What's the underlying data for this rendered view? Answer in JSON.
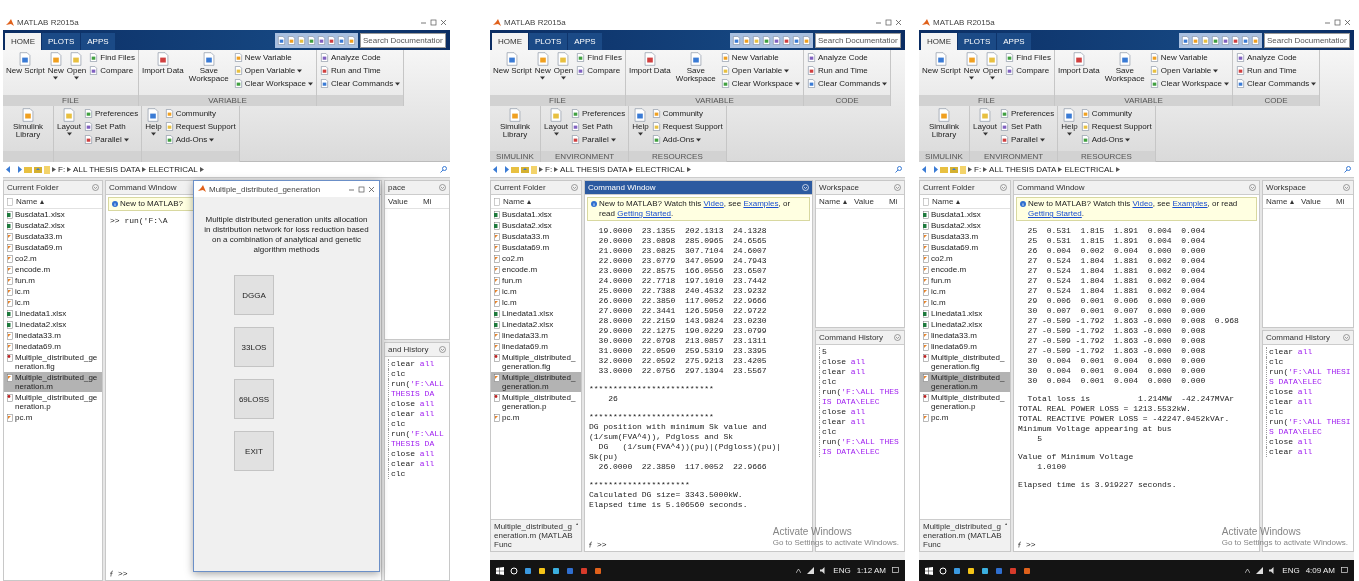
{
  "screens": [
    {
      "title": "MATLAB R2015a",
      "tabs": [
        {
          "label": "HOME",
          "selected": true
        },
        {
          "label": "PLOTS",
          "selected": false
        },
        {
          "label": "APPS",
          "selected": false
        }
      ],
      "search": {
        "placeholder": "Search Documentation"
      },
      "ribbon": [
        {
          "label": "FILE",
          "columns": [
            [
              {
                "kind": "large",
                "label": "New Script",
                "menu": false
              }
            ],
            [
              {
                "kind": "large",
                "label": "New",
                "menu": true
              }
            ],
            [
              {
                "kind": "large",
                "label": "Open",
                "menu": true
              }
            ],
            [
              {
                "kind": "small",
                "label": "Find Files",
                "menu": false
              },
              {
                "kind": "small",
                "label": "Compare",
                "menu": false
              }
            ]
          ]
        },
        {
          "label": "VARIABLE",
          "columns": [
            [
              {
                "kind": "large",
                "label": "Import Data",
                "menu": false
              }
            ],
            [
              {
                "kind": "large",
                "label": "Save Workspace",
                "menu": false
              }
            ],
            [
              {
                "kind": "small",
                "label": "New Variable",
                "menu": false
              },
              {
                "kind": "small",
                "label": "Open Variable",
                "menu": true
              },
              {
                "kind": "small",
                "label": "Clear Workspace",
                "menu": true
              }
            ]
          ]
        },
        {
          "columns": [
            [
              {
                "kind": "small",
                "label": "Analyze Code",
                "menu": false
              },
              {
                "kind": "small",
                "label": "Run and Time",
                "menu": false
              },
              {
                "kind": "small",
                "label": "Clear Commands",
                "menu": true
              }
            ]
          ]
        },
        {
          "columns": [
            [
              {
                "kind": "large",
                "label": "Simulink Library",
                "menu": false
              }
            ]
          ]
        },
        {
          "columns": [
            [
              {
                "kind": "large",
                "label": "Layout",
                "menu": true
              }
            ],
            [
              {
                "kind": "small",
                "label": "Preferences",
                "menu": false
              },
              {
                "kind": "small",
                "label": "Set Path",
                "menu": false
              },
              {
                "kind": "small",
                "label": "Parallel",
                "menu": true
              }
            ]
          ]
        },
        {
          "columns": [
            [
              {
                "kind": "large",
                "label": "Help",
                "menu": true
              }
            ],
            [
              {
                "kind": "small",
                "label": "Community",
                "menu": false
              },
              {
                "kind": "small",
                "label": "Request Support",
                "menu": false
              },
              {
                "kind": "small",
                "label": "Add-Ons",
                "menu": true
              }
            ]
          ]
        }
      ],
      "path": [
        "F:",
        "ALL THESIS DATA",
        "ELECTRICAL"
      ],
      "folder": {
        "title": "Current Folder",
        "column": "Name ▴",
        "files": [
          {
            "name": "Busdata1.xlsx",
            "kind": "sheet",
            "selected": false
          },
          {
            "name": "Busdata2.xlsx",
            "kind": "sheet",
            "selected": false
          },
          {
            "name": "Busdata33.m",
            "kind": "script",
            "selected": false
          },
          {
            "name": "Busdata69.m",
            "kind": "script",
            "selected": false
          },
          {
            "name": "co2.m",
            "kind": "script",
            "selected": false
          },
          {
            "name": "encode.m",
            "kind": "script",
            "selected": false
          },
          {
            "name": "fun.m",
            "kind": "script",
            "selected": false
          },
          {
            "name": "ic.m",
            "kind": "script",
            "selected": false
          },
          {
            "name": "lc.m",
            "kind": "script",
            "selected": false
          },
          {
            "name": "Linedata1.xlsx",
            "kind": "sheet",
            "selected": false
          },
          {
            "name": "Linedata2.xlsx",
            "kind": "sheet",
            "selected": false
          },
          {
            "name": "linedata33.m",
            "kind": "script",
            "selected": false
          },
          {
            "name": "linedata69.m",
            "kind": "script",
            "selected": false
          },
          {
            "name": "Multiple_distributed_generation.fig",
            "kind": "figure",
            "selected": false
          },
          {
            "name": "Multiple_distributed_generation.m",
            "kind": "script",
            "selected": true
          },
          {
            "name": "Multiple_distributed_generation.p",
            "kind": "figure",
            "selected": false
          },
          {
            "name": "pc.m",
            "kind": "script",
            "selected": false
          }
        ]
      },
      "command_window": {
        "title": "Command Window",
        "active": false,
        "info": [
          {
            "text": "New to MATLAB?",
            "link": false
          }
        ],
        "blocks": [
          [
            ">> run('F:\\A"
          ]
        ],
        "prompt": ">>"
      },
      "workspace": {
        "title": "pace",
        "columns": [
          "Value",
          "Mi"
        ]
      },
      "history": {
        "title": "and History",
        "items": [
          {
            "cmd": "clear",
            "arg": "all"
          },
          {
            "cmd": "clc"
          },
          {
            "cmd": "run(",
            "arg": "'F:\\ALL THESIS DA"
          },
          {
            "cmd": "close",
            "arg": "all"
          },
          {
            "cmd": "clear",
            "arg": "all"
          },
          {
            "cmd": "clc"
          },
          {
            "cmd": "run(",
            "arg": "'F:\\ALL THESIS DA"
          },
          {
            "cmd": "close",
            "arg": "all"
          },
          {
            "cmd": "clear",
            "arg": "all"
          },
          {
            "cmd": "clc"
          }
        ]
      },
      "dialog": {
        "title": "Multiple_distributed_generation",
        "heading": "Multiple distributed generation units allocation in distribution network for loss reduction based on a combination of analytical and genetic algorithm methods",
        "buttons": [
          "DGGA",
          "33LOS",
          "69LOSS",
          "EXIT"
        ]
      }
    },
    {
      "title": "MATLAB R2015a",
      "tabs": [
        {
          "label": "HOME",
          "selected": true
        },
        {
          "label": "PLOTS",
          "selected": false
        },
        {
          "label": "APPS",
          "selected": false
        }
      ],
      "search": {
        "placeholder": "Search Documentation"
      },
      "ribbon": [
        {
          "label": "FILE",
          "columns": [
            [
              {
                "kind": "large",
                "label": "New Script",
                "menu": false
              }
            ],
            [
              {
                "kind": "large",
                "label": "New",
                "menu": true
              }
            ],
            [
              {
                "kind": "large",
                "label": "Open",
                "menu": true
              }
            ],
            [
              {
                "kind": "small",
                "label": "Find Files",
                "menu": false
              },
              {
                "kind": "small",
                "label": "Compare",
                "menu": false
              }
            ]
          ]
        },
        {
          "label": "VARIABLE",
          "columns": [
            [
              {
                "kind": "large",
                "label": "Import Data",
                "menu": false
              }
            ],
            [
              {
                "kind": "large",
                "label": "Save Workspace",
                "menu": false
              }
            ],
            [
              {
                "kind": "small",
                "label": "New Variable",
                "menu": false
              },
              {
                "kind": "small",
                "label": "Open Variable",
                "menu": true
              },
              {
                "kind": "small",
                "label": "Clear Workspace",
                "menu": true
              }
            ]
          ]
        },
        {
          "label": "CODE",
          "columns": [
            [
              {
                "kind": "small",
                "label": "Analyze Code",
                "menu": false
              },
              {
                "kind": "small",
                "label": "Run and Time",
                "menu": false
              },
              {
                "kind": "small",
                "label": "Clear Commands",
                "menu": true
              }
            ]
          ]
        },
        {
          "label": "SIMULINK",
          "columns": [
            [
              {
                "kind": "large",
                "label": "Simulink Library",
                "menu": false
              }
            ]
          ]
        },
        {
          "label": "ENVIRONMENT",
          "columns": [
            [
              {
                "kind": "large",
                "label": "Layout",
                "menu": true
              }
            ],
            [
              {
                "kind": "small",
                "label": "Preferences",
                "menu": false
              },
              {
                "kind": "small",
                "label": "Set Path",
                "menu": false
              },
              {
                "kind": "small",
                "label": "Parallel",
                "menu": true
              }
            ]
          ]
        },
        {
          "label": "RESOURCES",
          "columns": [
            [
              {
                "kind": "large",
                "label": "Help",
                "menu": true
              }
            ],
            [
              {
                "kind": "small",
                "label": "Community",
                "menu": false
              },
              {
                "kind": "small",
                "label": "Request Support",
                "menu": false
              },
              {
                "kind": "small",
                "label": "Add-Ons",
                "menu": true
              }
            ]
          ]
        }
      ],
      "path": [
        "F:",
        "ALL THESIS DATA",
        "ELECTRICAL"
      ],
      "folder": {
        "title": "Current Folder",
        "column": "Name ▴",
        "details": "Multiple_distributed_generation.m (MATLAB Func",
        "files": [
          {
            "name": "Busdata1.xlsx",
            "kind": "sheet",
            "selected": false
          },
          {
            "name": "Busdata2.xlsx",
            "kind": "sheet",
            "selected": false
          },
          {
            "name": "Busdata33.m",
            "kind": "script",
            "selected": false
          },
          {
            "name": "Busdata69.m",
            "kind": "script",
            "selected": false
          },
          {
            "name": "co2.m",
            "kind": "script",
            "selected": false
          },
          {
            "name": "encode.m",
            "kind": "script",
            "selected": false
          },
          {
            "name": "fun.m",
            "kind": "script",
            "selected": false
          },
          {
            "name": "ic.m",
            "kind": "script",
            "selected": false
          },
          {
            "name": "lc.m",
            "kind": "script",
            "selected": false
          },
          {
            "name": "Linedata1.xlsx",
            "kind": "sheet",
            "selected": false
          },
          {
            "name": "Linedata2.xlsx",
            "kind": "sheet",
            "selected": false
          },
          {
            "name": "linedata33.m",
            "kind": "script",
            "selected": false
          },
          {
            "name": "linedata69.m",
            "kind": "script",
            "selected": false
          },
          {
            "name": "Multiple_distributed_generation.fig",
            "kind": "figure",
            "selected": false
          },
          {
            "name": "Multiple_distributed_generation.m",
            "kind": "script",
            "selected": true
          },
          {
            "name": "Multiple_distributed_generation.p",
            "kind": "figure",
            "selected": false
          },
          {
            "name": "pc.m",
            "kind": "script",
            "selected": false
          }
        ]
      },
      "command_window": {
        "title": "Command Window",
        "active": true,
        "info": [
          {
            "text": "New to MATLAB? Watch this ",
            "link": false
          },
          {
            "text": "Video",
            "link": true
          },
          {
            "text": ", see ",
            "link": false
          },
          {
            "text": "Examples",
            "link": true
          },
          {
            "text": ", or read ",
            "link": false
          },
          {
            "text": "Getting Started",
            "link": true
          },
          {
            "text": ".",
            "link": false
          }
        ],
        "blocks": [
          [
            "  19.0000  23.1355  202.1313  24.1328",
            "  20.0000  23.0898  285.0965  24.6565",
            "  21.0000  23.0825  307.7104  24.6007",
            "  22.0000  23.0779  347.0599  24.7943",
            "  23.0000  22.8575  166.0556  23.6507",
            "  24.0000  22.7718  197.1010  23.7442",
            "  25.0000  22.7388  240.4532  23.9232",
            "  26.0000  22.3850  117.0052  22.9666",
            "  27.0000  22.3441  126.5950  22.9722",
            "  28.0000  22.2159  143.9824  23.0230",
            "  29.0000  22.1275  190.0229  23.0799",
            "  30.0000  22.0798  213.0857  23.1311",
            "  31.0000  22.0590  259.5319  23.3395",
            "  32.0000  22.0592  275.9213  23.4205",
            "  33.0000  22.0756  297.1394  23.5567"
          ],
          [
            "**************************",
            "    26"
          ],
          [
            "**************************",
            "DG position with minimum Sk value and (1/sum(FVA^4)), Pdgloss and Sk",
            "  DG   (1/sum(FVA^4))(pu)|(Pdgloss)(pu)| Sk(pu)",
            "  26.0000  22.3850  117.0052  22.9666"
          ],
          [
            "*********************",
            "Calculated DG size= 3343.5000kW.",
            "Elapsed time is 5.106560 seconds."
          ]
        ],
        "prompt": ">>"
      },
      "workspace": {
        "title": "Workspace",
        "columns": [
          "Name ▴",
          "Value",
          "Mi"
        ]
      },
      "history": {
        "title": "Command History",
        "items": [
          {
            "cmd": "5"
          },
          {
            "cmd": "close",
            "arg": "all"
          },
          {
            "cmd": "clear",
            "arg": "all"
          },
          {
            "cmd": "clc"
          },
          {
            "cmd": "run(",
            "arg": "'F:\\ALL THESIS DATA\\ELEC"
          },
          {
            "cmd": "close",
            "arg": "all"
          },
          {
            "cmd": "clear",
            "arg": "all"
          },
          {
            "cmd": "clc"
          },
          {
            "cmd": "run(",
            "arg": "'F:\\ALL THESIS DATA\\ELEC"
          }
        ]
      },
      "activation": {
        "title": "Activate Windows",
        "subtitle": "Go to Settings to activate Windows."
      },
      "taskbar": {
        "language": "ENG",
        "time": "1:12 AM"
      }
    },
    {
      "title": "MATLAB R2015a",
      "tabs": [
        {
          "label": "HOME",
          "selected": true
        },
        {
          "label": "PLOTS",
          "selected": false
        },
        {
          "label": "APPS",
          "selected": false
        }
      ],
      "search": {
        "placeholder": "Search Documentation"
      },
      "ribbon": [
        {
          "label": "FILE",
          "columns": [
            [
              {
                "kind": "large",
                "label": "New Script",
                "menu": false
              }
            ],
            [
              {
                "kind": "large",
                "label": "New",
                "menu": true
              }
            ],
            [
              {
                "kind": "large",
                "label": "Open",
                "menu": true
              }
            ],
            [
              {
                "kind": "small",
                "label": "Find Files",
                "menu": false
              },
              {
                "kind": "small",
                "label": "Compare",
                "menu": false
              }
            ]
          ]
        },
        {
          "label": "VARIABLE",
          "columns": [
            [
              {
                "kind": "large",
                "label": "Import Data",
                "menu": false
              }
            ],
            [
              {
                "kind": "large",
                "label": "Save Workspace",
                "menu": false
              }
            ],
            [
              {
                "kind": "small",
                "label": "New Variable",
                "menu": false
              },
              {
                "kind": "small",
                "label": "Open Variable",
                "menu": true
              },
              {
                "kind": "small",
                "label": "Clear Workspace",
                "menu": true
              }
            ]
          ]
        },
        {
          "label": "CODE",
          "columns": [
            [
              {
                "kind": "small",
                "label": "Analyze Code",
                "menu": false
              },
              {
                "kind": "small",
                "label": "Run and Time",
                "menu": false
              },
              {
                "kind": "small",
                "label": "Clear Commands",
                "menu": true
              }
            ]
          ]
        },
        {
          "label": "SIMULINK",
          "columns": [
            [
              {
                "kind": "large",
                "label": "Simulink Library",
                "menu": false
              }
            ]
          ]
        },
        {
          "label": "ENVIRONMENT",
          "columns": [
            [
              {
                "kind": "large",
                "label": "Layout",
                "menu": true
              }
            ],
            [
              {
                "kind": "small",
                "label": "Preferences",
                "menu": false
              },
              {
                "kind": "small",
                "label": "Set Path",
                "menu": false
              },
              {
                "kind": "small",
                "label": "Parallel",
                "menu": true
              }
            ]
          ]
        },
        {
          "label": "RESOURCES",
          "columns": [
            [
              {
                "kind": "large",
                "label": "Help",
                "menu": true
              }
            ],
            [
              {
                "kind": "small",
                "label": "Community",
                "menu": false
              },
              {
                "kind": "small",
                "label": "Request Support",
                "menu": false
              },
              {
                "kind": "small",
                "label": "Add-Ons",
                "menu": true
              }
            ]
          ]
        }
      ],
      "path": [
        "F:",
        "ALL THESIS DATA",
        "ELECTRICAL"
      ],
      "folder": {
        "title": "Current Folder",
        "column": "Name ▴",
        "details": "Multiple_distributed_generation.m (MATLAB Func",
        "files": [
          {
            "name": "Busdata1.xlsx",
            "kind": "sheet",
            "selected": false
          },
          {
            "name": "Busdata2.xlsx",
            "kind": "sheet",
            "selected": false
          },
          {
            "name": "Busdata33.m",
            "kind": "script",
            "selected": false
          },
          {
            "name": "Busdata69.m",
            "kind": "script",
            "selected": false
          },
          {
            "name": "co2.m",
            "kind": "script",
            "selected": false
          },
          {
            "name": "encode.m",
            "kind": "script",
            "selected": false
          },
          {
            "name": "fun.m",
            "kind": "script",
            "selected": false
          },
          {
            "name": "ic.m",
            "kind": "script",
            "selected": false
          },
          {
            "name": "lc.m",
            "kind": "script",
            "selected": false
          },
          {
            "name": "Linedata1.xlsx",
            "kind": "sheet",
            "selected": false
          },
          {
            "name": "Linedata2.xlsx",
            "kind": "sheet",
            "selected": false
          },
          {
            "name": "linedata33.m",
            "kind": "script",
            "selected": false
          },
          {
            "name": "linedata69.m",
            "kind": "script",
            "selected": false
          },
          {
            "name": "Multiple_distributed_generation.fig",
            "kind": "figure",
            "selected": false
          },
          {
            "name": "Multiple_distributed_generation.m",
            "kind": "script",
            "selected": true
          },
          {
            "name": "Multiple_distributed_generation.p",
            "kind": "figure",
            "selected": false
          },
          {
            "name": "pc.m",
            "kind": "script",
            "selected": false
          }
        ]
      },
      "command_window": {
        "title": "Command Window",
        "active": false,
        "info": [
          {
            "text": "New to MATLAB? Watch this ",
            "link": false
          },
          {
            "text": "Video",
            "link": true
          },
          {
            "text": ", see ",
            "link": false
          },
          {
            "text": "Examples",
            "link": true
          },
          {
            "text": ", or read ",
            "link": false
          },
          {
            "text": "Getting Started",
            "link": true
          },
          {
            "text": ".",
            "link": false
          }
        ],
        "blocks": [
          [
            "  25  0.531  1.815  1.891  0.004  0.004",
            "  25  0.531  1.815  1.891  0.004  0.004",
            "  26  0.004  0.002  0.004  0.000  0.000",
            "  27  0.524  1.804  1.881  0.002  0.004",
            "  27  0.524  1.804  1.881  0.002  0.004",
            "  27  0.524  1.804  1.881  0.002  0.004",
            "  27  0.524  1.804  1.881  0.002  0.004",
            "  29  0.006  0.001  0.006  0.000  0.000",
            "  30  0.007  0.001  0.007  0.000  0.000",
            "  27 -0.509 -1.792  1.863 -0.000  0.008  0.968",
            "  27 -0.509 -1.792  1.863 -0.000  0.008",
            "  27 -0.509 -1.792  1.863 -0.000  0.008",
            "  27 -0.509 -1.792  1.863 -0.000  0.008",
            "  30  0.004  0.001  0.004  0.000  0.000",
            "  30  0.004  0.001  0.004  0.000  0.000",
            "  30  0.004  0.001  0.004  0.000  0.000"
          ],
          [
            "  Total loss is          1.214MW  -42.247MVAr",
            "TOTAL REAL POWER LOSS = 1213.5532kW.",
            "TOTAL REACTIVE POWER LOSS = -42247.0452kVAr.",
            "Minimum Voltage appearing at bus",
            "    5"
          ],
          [
            "Value of Minimum Voltage",
            "    1.0100"
          ],
          [
            "Elapsed time is 3.919227 seconds."
          ]
        ],
        "prompt": ">>"
      },
      "workspace": {
        "title": "Workspace",
        "columns": [
          "Name ▴",
          "Value",
          "Mi"
        ]
      },
      "history": {
        "title": "Command History",
        "items": [
          {
            "cmd": "clear",
            "arg": "all"
          },
          {
            "cmd": "clc"
          },
          {
            "cmd": "run(",
            "arg": "'F:\\ALL THESIS DATA\\ELEC"
          },
          {
            "cmd": "close",
            "arg": "all"
          },
          {
            "cmd": "clear",
            "arg": "all"
          },
          {
            "cmd": "clc"
          },
          {
            "cmd": "run(",
            "arg": "'F:\\ALL THESIS DATA\\ELEC"
          },
          {
            "cmd": "close",
            "arg": "all"
          },
          {
            "cmd": "clear",
            "arg": "all"
          }
        ]
      },
      "activation": {
        "title": "Activate Windows",
        "subtitle": "Go to Settings to activate Windows."
      },
      "taskbar": {
        "language": "ENG",
        "time": "4:09 AM"
      }
    }
  ]
}
